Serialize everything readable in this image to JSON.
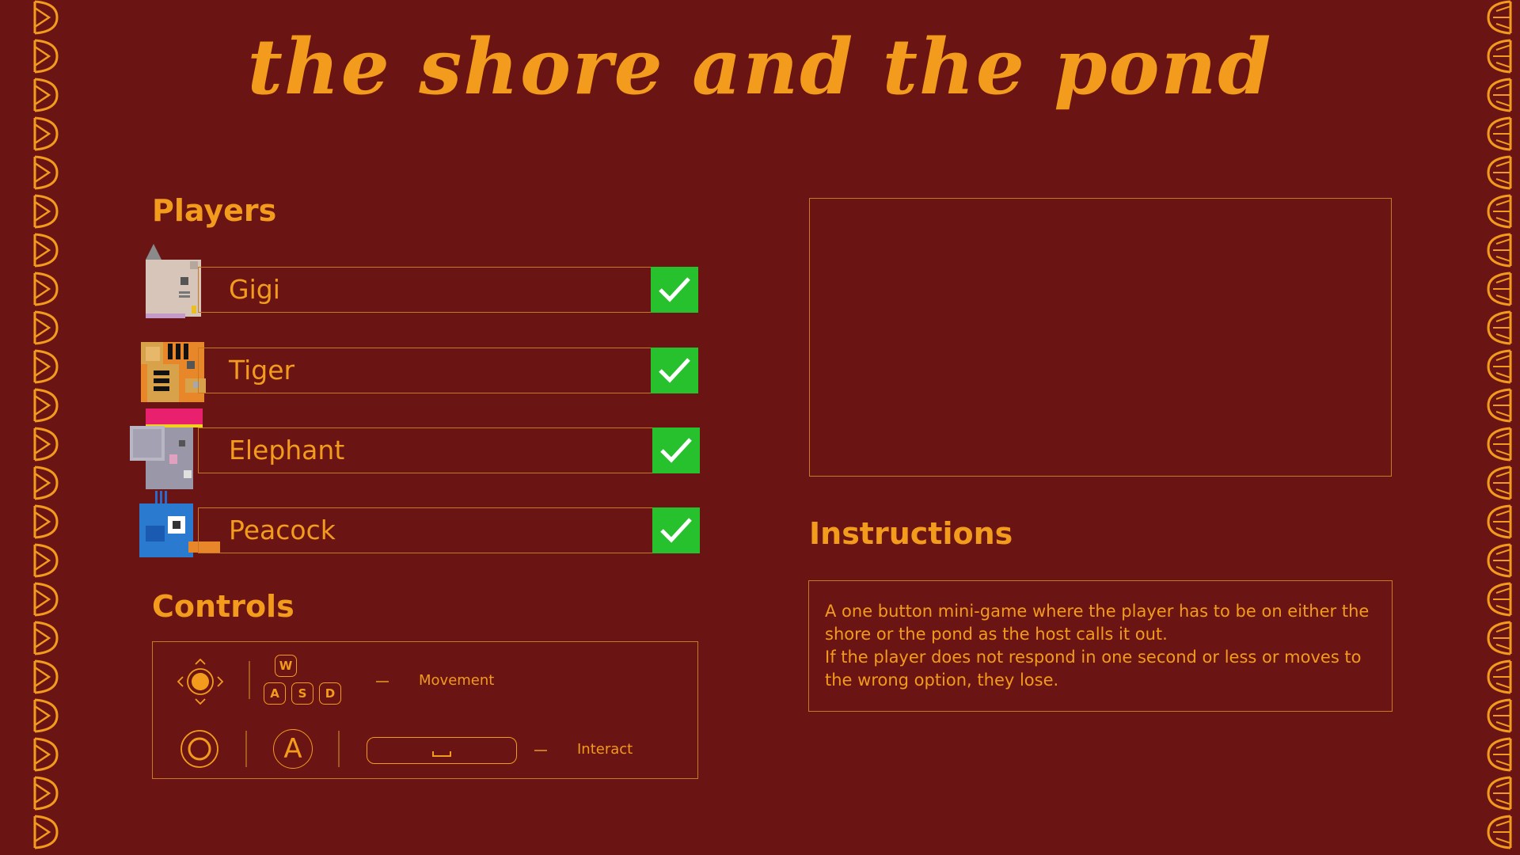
{
  "title": "the shore and the pond",
  "colors": {
    "background": "#6b1414",
    "accent": "#f29b1c",
    "check": "#27c12e"
  },
  "players_heading": "Players",
  "players": [
    {
      "name": "Gigi",
      "avatar": "cat-icon",
      "ready": true
    },
    {
      "name": "Tiger",
      "avatar": "tiger-icon",
      "ready": true
    },
    {
      "name": "Elephant",
      "avatar": "elephant-icon",
      "ready": true
    },
    {
      "name": "Peacock",
      "avatar": "peacock-icon",
      "ready": true
    }
  ],
  "controls_heading": "Controls",
  "controls": {
    "movement_label": "Movement",
    "interact_label": "Interact",
    "keys": {
      "up": "W",
      "left": "A",
      "down": "S",
      "right": "D",
      "gamepad_interact": "A"
    }
  },
  "instructions_heading": "Instructions",
  "instructions": [
    "A one button mini-game where the player has to be on either the",
    "shore or the pond as the host calls it out.",
    "If the player does not respond in one second or less or moves to",
    "the wrong option, they lose."
  ]
}
